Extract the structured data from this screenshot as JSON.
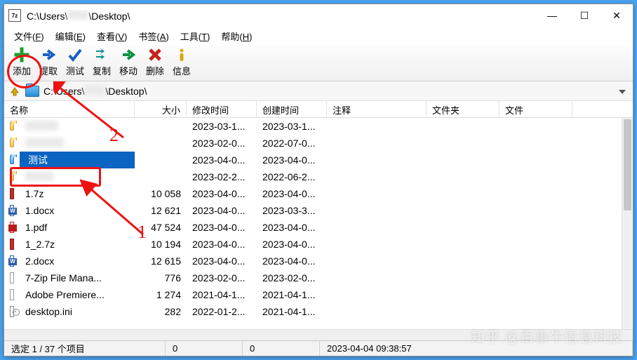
{
  "window": {
    "title_prefix": "C:\\Users\\",
    "title_blur": "xxxxxx",
    "title_suffix": "\\Desktop\\",
    "minimize": "—",
    "maximize": "☐",
    "close": "✕"
  },
  "menu": [
    {
      "label": "文件",
      "accel": "F"
    },
    {
      "label": "编辑",
      "accel": "E"
    },
    {
      "label": "查看",
      "accel": "V"
    },
    {
      "label": "书签",
      "accel": "A"
    },
    {
      "label": "工具",
      "accel": "T"
    },
    {
      "label": "帮助",
      "accel": "H"
    }
  ],
  "toolbar": [
    {
      "name": "add",
      "label": "添加",
      "icon": "plus",
      "color": "#17a32d"
    },
    {
      "name": "extract",
      "label": "提取",
      "icon": "arrow-right",
      "color": "#1662c4"
    },
    {
      "name": "test",
      "label": "测试",
      "icon": "check",
      "color": "#1662c4"
    },
    {
      "name": "copy",
      "label": "复制",
      "icon": "dbl-arrow",
      "color": "#0a8f93"
    },
    {
      "name": "move",
      "label": "移动",
      "icon": "arrow-right",
      "color": "#0a9140"
    },
    {
      "name": "delete",
      "label": "删除",
      "icon": "x",
      "color": "#c4261d"
    },
    {
      "name": "info",
      "label": "信息",
      "icon": "i",
      "color": "#d8a90f"
    }
  ],
  "address": {
    "prefix": "C:\\Users\\",
    "blur": "xxxxxx",
    "suffix": "\\Desktop\\"
  },
  "columns": {
    "name": "名称",
    "size": "大小",
    "mtime": "修改时间",
    "ctime": "创建时间",
    "note": "注释",
    "dir": "文件夹",
    "file": "文件"
  },
  "rows": [
    {
      "icon": "folder",
      "name_blur": true,
      "name": " ",
      "size": "",
      "mtime": "2023-03-1...",
      "ctime": "2023-03-1..."
    },
    {
      "icon": "folder",
      "name_blur": true,
      "name": " ",
      "size": "",
      "mtime": "2023-02-0...",
      "ctime": "2022-07-0..."
    },
    {
      "icon": "folder-blue",
      "selected": true,
      "name": "测试",
      "size": "",
      "mtime": "2023-04-0...",
      "ctime": "2023-04-0..."
    },
    {
      "icon": "folder",
      "name_blur": true,
      "name": " ",
      "size": "",
      "mtime": "2023-02-2...",
      "ctime": "2022-06-2..."
    },
    {
      "icon": "7z",
      "name": "1.7z",
      "size": "10 058",
      "mtime": "2023-04-0...",
      "ctime": "2023-04-0..."
    },
    {
      "icon": "doc",
      "name": "1.docx",
      "size": "12 621",
      "mtime": "2023-04-0...",
      "ctime": "2023-03-3..."
    },
    {
      "icon": "pdf",
      "name": "1.pdf",
      "size": "47 524",
      "mtime": "2023-04-0...",
      "ctime": "2023-04-0..."
    },
    {
      "icon": "7z",
      "name": "1_2.7z",
      "size": "10 194",
      "mtime": "2023-04-0...",
      "ctime": "2023-04-0..."
    },
    {
      "icon": "doc",
      "name": "2.docx",
      "size": "12 615",
      "mtime": "2023-04-0...",
      "ctime": "2023-04-0..."
    },
    {
      "icon": "txt",
      "name": "7-Zip File Mana...",
      "size": "776",
      "mtime": "2023-02-0...",
      "ctime": "2023-02-0..."
    },
    {
      "icon": "txt",
      "name": "Adobe Premiere...",
      "size": "1 274",
      "mtime": "2021-04-1...",
      "ctime": "2021-04-1..."
    },
    {
      "icon": "ini",
      "name": "desktop.ini",
      "size": "282",
      "mtime": "2022-01-2...",
      "ctime": "2021-04-1..."
    }
  ],
  "status": {
    "selection": "选定 1 / 37 个项目",
    "n1": "0",
    "n2": "0",
    "timestamp": "2023-04-04 09:38:57"
  },
  "annotations": {
    "num1": "1",
    "num2": "2"
  },
  "watermark": "知乎 @百事牛信息科技"
}
